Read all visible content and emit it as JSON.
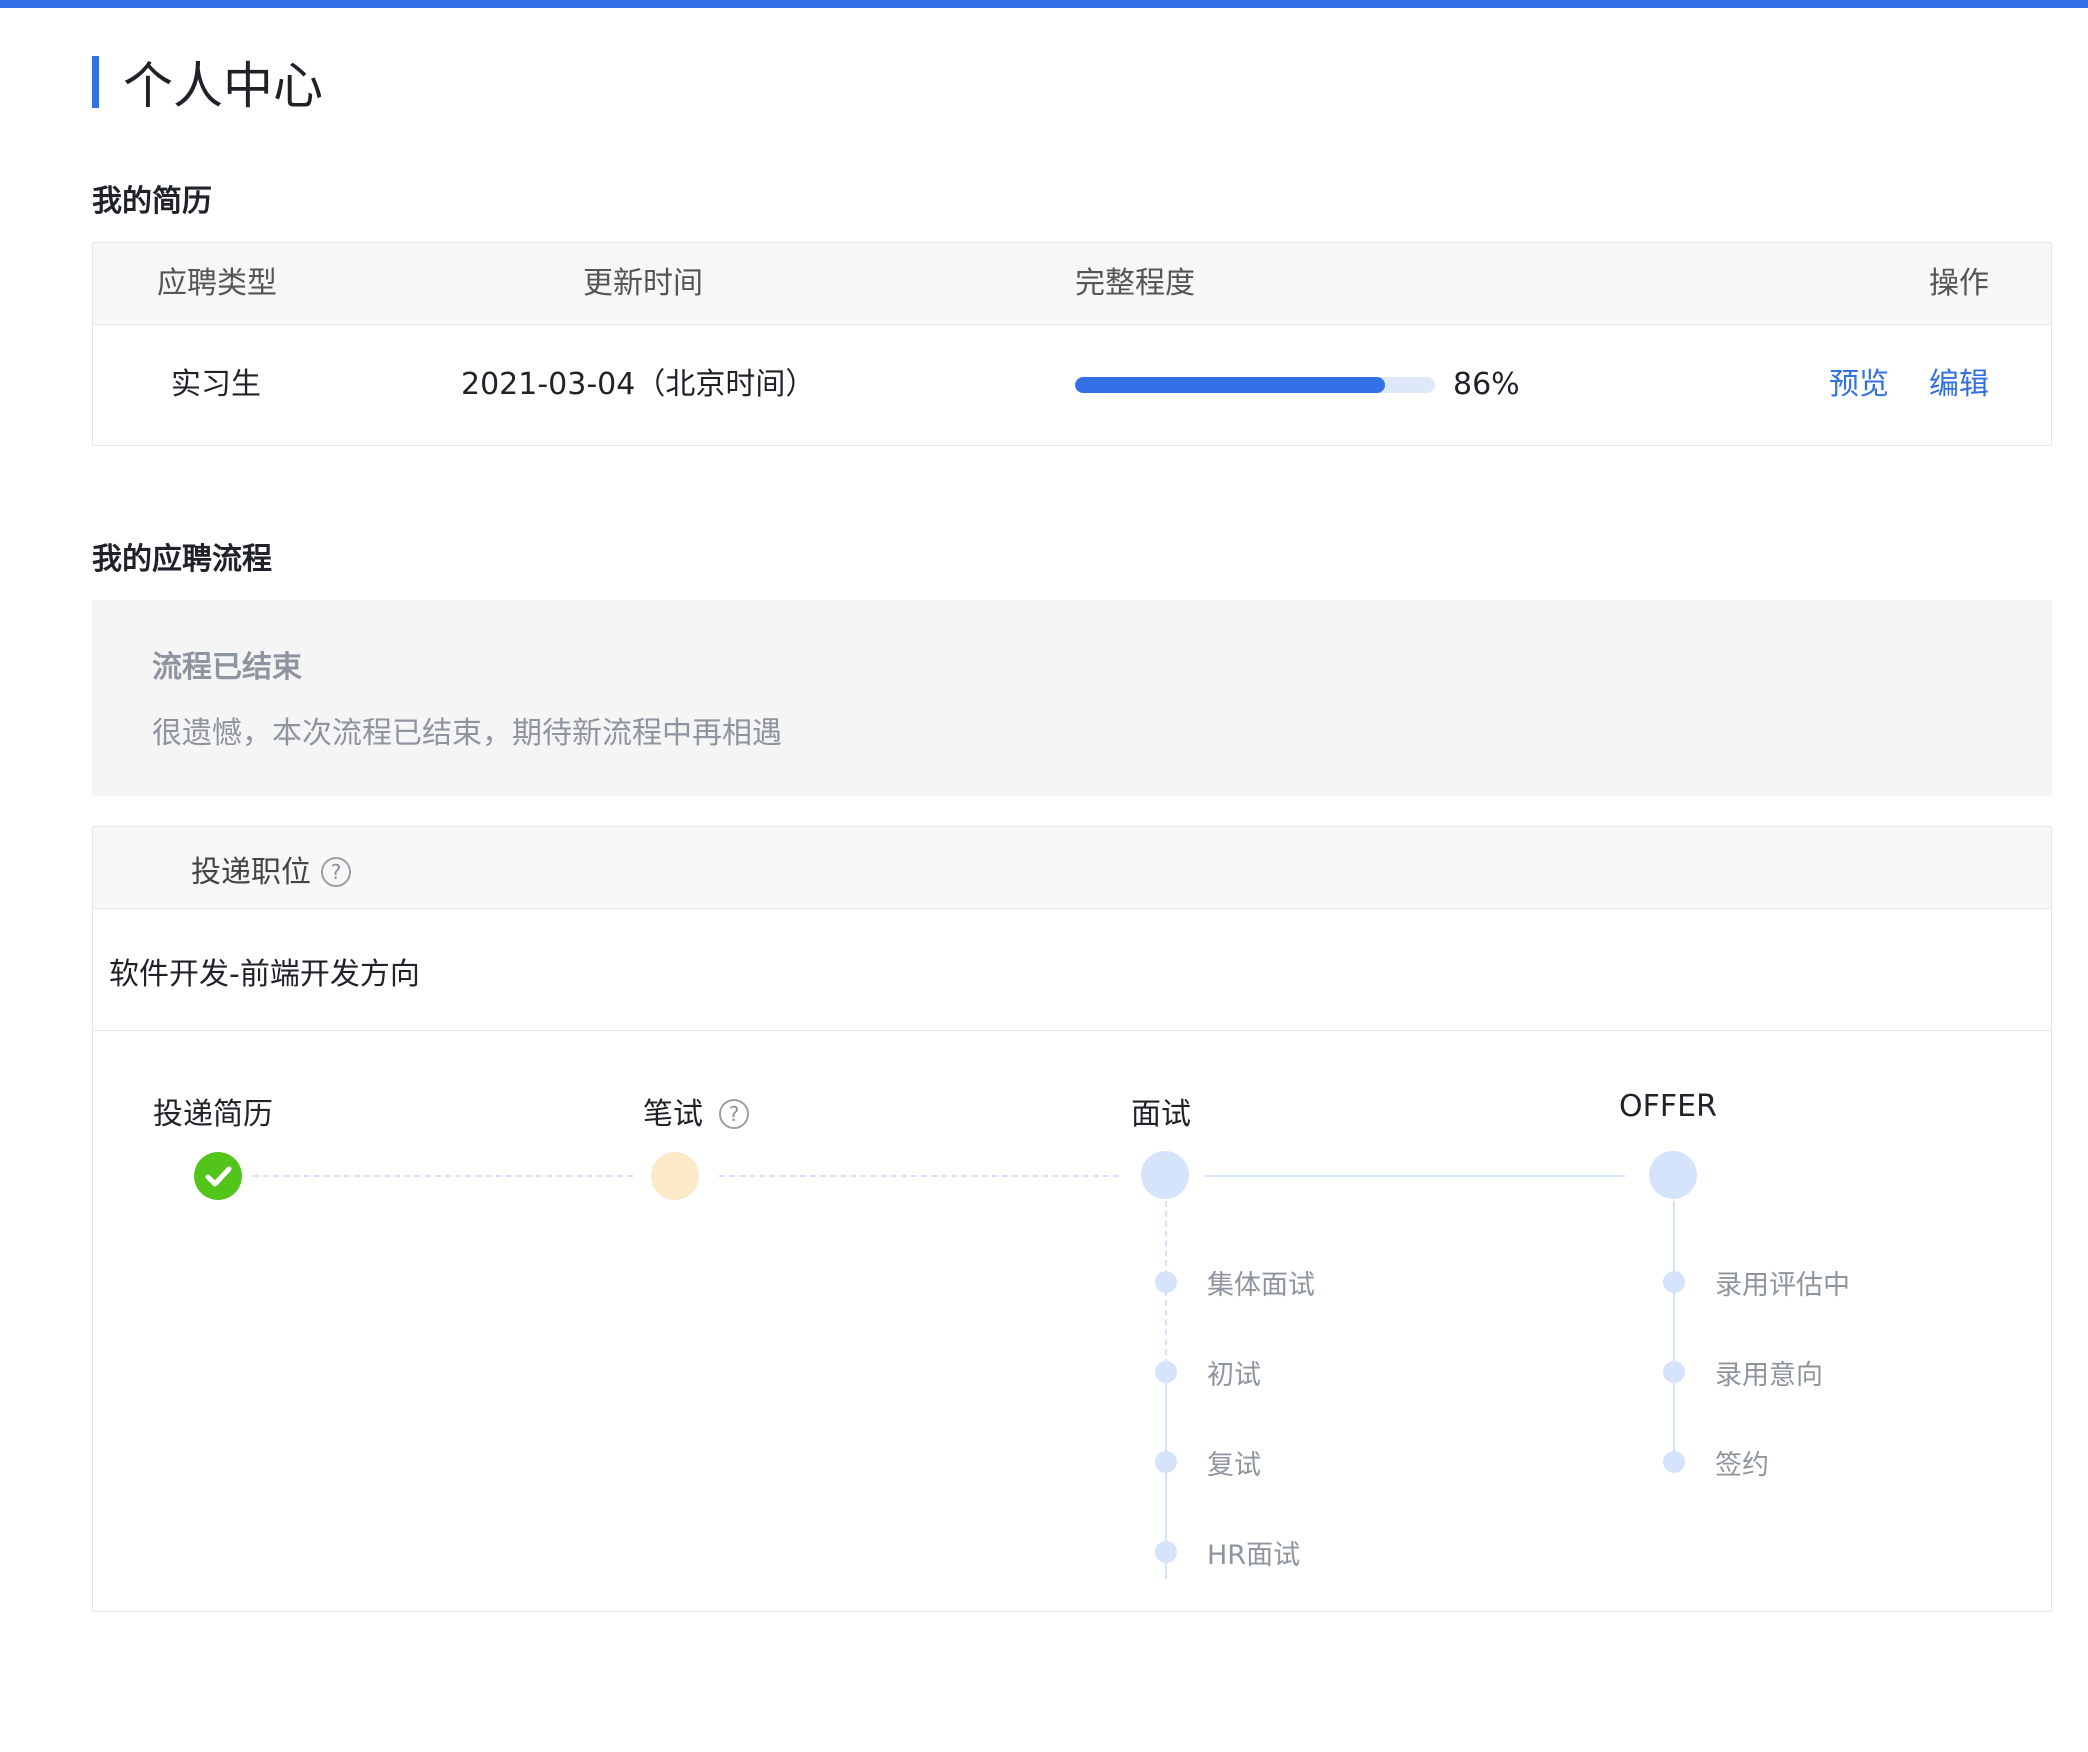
{
  "page": {
    "title": "个人中心"
  },
  "resume": {
    "section_title": "我的简历",
    "headers": {
      "type": "应聘类型",
      "updated": "更新时间",
      "completeness": "完整程度",
      "actions": "操作"
    },
    "row": {
      "type": "实习生",
      "updated": "2021-03-04（北京时间）",
      "completeness_percent": 86,
      "completeness_label": "86%",
      "preview": "预览",
      "edit": "编辑"
    }
  },
  "process": {
    "section_title": "我的应聘流程",
    "notice_title": "流程已结束",
    "notice_message": "很遗憾，本次流程已结束，期待新流程中再相遇",
    "position_header": "投递职位",
    "help_glyph": "?",
    "position_name": "软件开发-前端开发方向",
    "stages": {
      "submit": {
        "label": "投递简历",
        "status": "done"
      },
      "exam": {
        "label": "笔试",
        "status": "pending"
      },
      "interview": {
        "label": "面试",
        "sub": [
          "集体面试",
          "初试",
          "复试",
          "HR面试"
        ]
      },
      "offer": {
        "label": "OFFER",
        "sub": [
          "录用评估中",
          "录用意向",
          "签约"
        ]
      }
    }
  },
  "colors": {
    "accent": "#3370e6",
    "success": "#52c41a",
    "pending": "#fbe9c8",
    "inactive_node": "#d6e4fb",
    "muted_text": "#8f959e"
  }
}
